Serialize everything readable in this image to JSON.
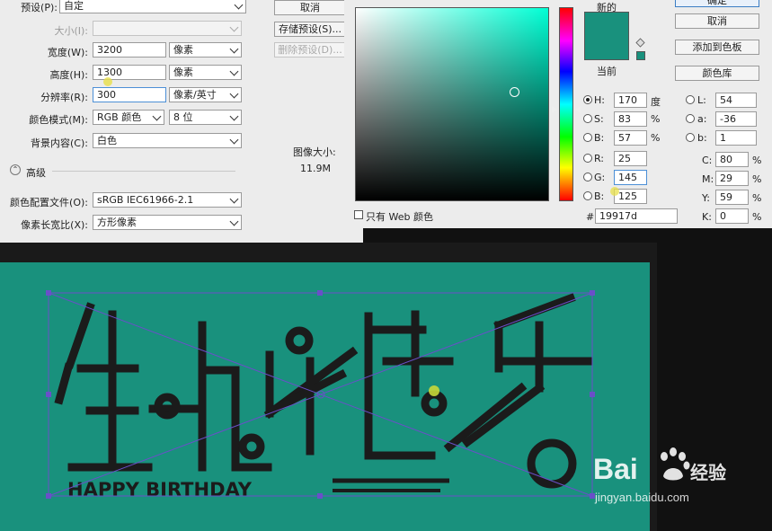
{
  "new_document_dialog": {
    "preset_label": "预设(P):",
    "preset_value": "自定",
    "size_label": "大小(I):",
    "width_label": "宽度(W):",
    "width_value": "3200",
    "width_unit": "像素",
    "height_label": "高度(H):",
    "height_value": "1300",
    "height_unit": "像素",
    "resolution_label": "分辨率(R):",
    "resolution_value": "300",
    "resolution_unit": "像素/英寸",
    "color_mode_label": "颜色模式(M):",
    "color_mode_value": "RGB 颜色",
    "bit_depth_value": "8 位",
    "background_label": "背景内容(C):",
    "background_value": "白色",
    "advanced_label": "高级",
    "color_profile_label": "颜色配置文件(O):",
    "color_profile_value": "sRGB IEC61966-2.1",
    "pixel_aspect_label": "像素长宽比(X):",
    "pixel_aspect_value": "方形像素",
    "cancel_button": "取消",
    "save_preset_button": "存储预设(S)...",
    "delete_preset_button": "删除预设(D)...",
    "image_size_label": "图像大小:",
    "image_size_value": "11.9M"
  },
  "color_picker": {
    "new_label": "新的",
    "current_label": "当前",
    "ok_button": "确定",
    "cancel_button": "取消",
    "add_swatch_button": "添加到色板",
    "color_libraries_button": "颜色库",
    "web_only_label": "只有 Web 颜色",
    "hex_prefix": "#",
    "hex_value": "19917d",
    "h_label": "H:",
    "h_value": "170",
    "h_unit": "度",
    "s_label": "S:",
    "s_value": "83",
    "s_unit": "%",
    "b_label": "B:",
    "b_value": "57",
    "b_unit": "%",
    "r_label": "R:",
    "r_value": "25",
    "g_label": "G:",
    "g_value": "145",
    "bl_label": "B:",
    "bl_value": "125",
    "l_label": "L:",
    "l_value": "54",
    "a_label": "a:",
    "a_value": "-36",
    "lab_b_label": "b:",
    "lab_b_value": "1",
    "c_label": "C:",
    "c_value": "80",
    "c_unit": "%",
    "m_label": "M:",
    "m_value": "29",
    "m_unit": "%",
    "y_label": "Y:",
    "y_value": "59",
    "y_unit": "%",
    "k_label": "K:",
    "k_value": "0",
    "k_unit": "%"
  },
  "canvas": {
    "artwork_subtitle": "HAPPY BIRTHDAY"
  },
  "watermark": {
    "brand": "Bai",
    "brand_cn": "经验",
    "url": "jingyan.baidu.com"
  },
  "colors": {
    "canvas_teal": "#19917d",
    "art_dark": "#1b1b1b",
    "transform_box": "#6a4fc9",
    "cursor_highlight": "#c8d83a"
  }
}
